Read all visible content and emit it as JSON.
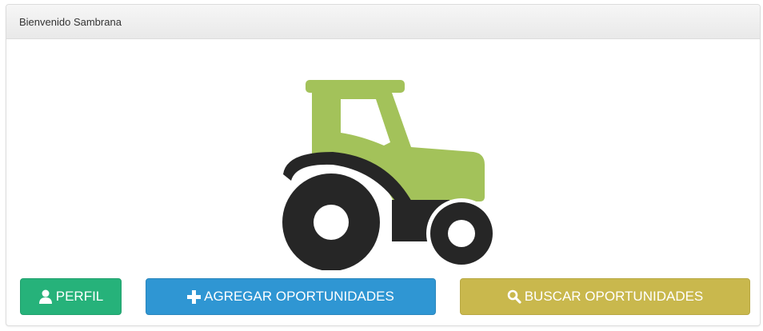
{
  "panel": {
    "heading": "Bienvenido Sambrana"
  },
  "hero": {
    "icon": "tractor-icon",
    "colors": {
      "cab": "#a3c25a",
      "wheels": "#262626"
    }
  },
  "actions": {
    "perfil": {
      "label": "PERFIL",
      "icon": "user-icon",
      "color": "#26b27a"
    },
    "agregar": {
      "label": "AGREGAR OPORTUNIDADES",
      "icon": "plus-icon",
      "color": "#2f96d3"
    },
    "buscar": {
      "label": "BUSCAR OPORTUNIDADES",
      "icon": "search-icon",
      "color": "#c9b84d"
    }
  }
}
